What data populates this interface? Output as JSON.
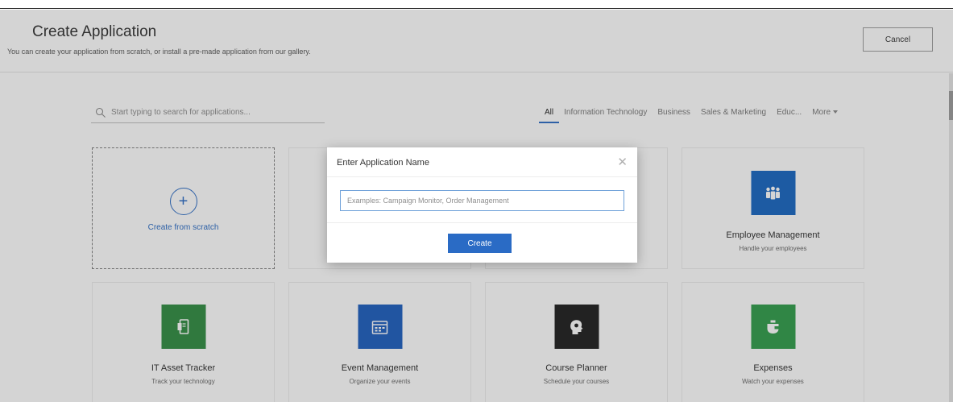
{
  "header": {
    "title": "Create Application",
    "subtitle": "You can create your application from scratch, or install a pre-made application from our gallery.",
    "cancel_label": "Cancel"
  },
  "search": {
    "placeholder": "Start typing to search for applications..."
  },
  "filters": {
    "tabs": [
      {
        "label": "All",
        "active": true
      },
      {
        "label": "Information Technology",
        "active": false
      },
      {
        "label": "Business",
        "active": false
      },
      {
        "label": "Sales & Marketing",
        "active": false
      },
      {
        "label": "Educ...",
        "active": false
      }
    ],
    "more_label": "More"
  },
  "scratch": {
    "label": "Create from scratch",
    "plus": "+"
  },
  "cards": [
    {
      "title": "Employee Management",
      "description": "Handle your employees",
      "icon": "people-group-icon",
      "color": "#1565c0"
    },
    {
      "title": "IT Asset Tracker",
      "description": "Track your technology",
      "icon": "asset-device-icon",
      "color": "#2e8b3f"
    },
    {
      "title": "Event Management",
      "description": "Organize your events",
      "icon": "calendar-icon",
      "color": "#1a5dbe"
    },
    {
      "title": "Course Planner",
      "description": "Schedule your courses",
      "icon": "head-gear-icon",
      "color": "#1c1c1c"
    },
    {
      "title": "Expenses",
      "description": "Watch your expenses",
      "icon": "wallet-icon",
      "color": "#2e9b48"
    }
  ],
  "modal": {
    "title": "Enter Application Name",
    "placeholder": "Examples: Campaign Monitor, Order Management",
    "create_label": "Create",
    "close_glyph": "✕"
  },
  "colors": {
    "accent": "#2a6bc5"
  }
}
